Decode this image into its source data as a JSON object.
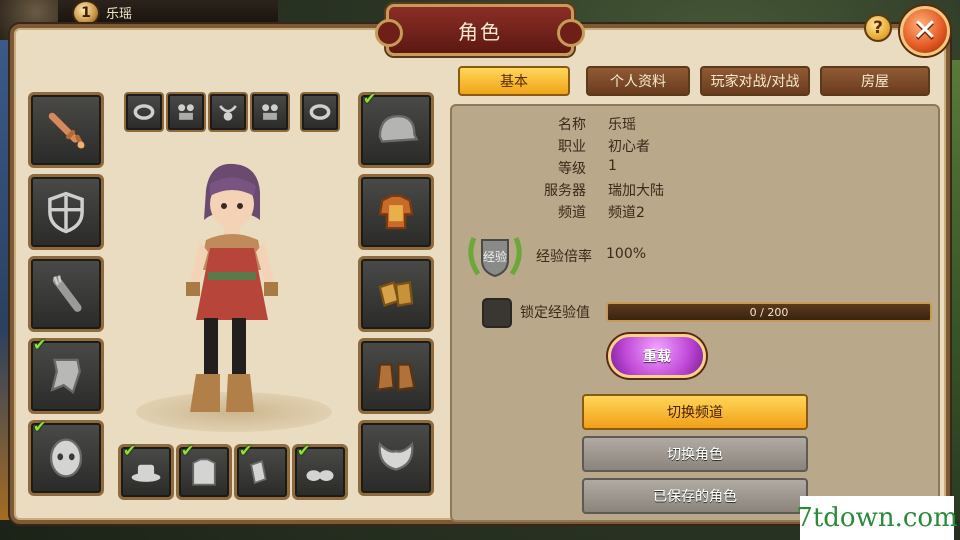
{
  "player": {
    "level": "1",
    "name": "乐瑶"
  },
  "window": {
    "title": "角色",
    "help_label": "?",
    "close_label": "✕"
  },
  "equipment": {
    "left_slots": [
      {
        "icon": "sword-icon",
        "equipped": false
      },
      {
        "icon": "shield-icon",
        "equipped": false
      },
      {
        "icon": "quiver-icon",
        "equipped": false
      },
      {
        "icon": "cape-icon",
        "equipped": true
      },
      {
        "icon": "mask-icon",
        "equipped": true
      }
    ],
    "top_slots": [
      {
        "icon": "ring-icon"
      },
      {
        "icon": "earring-icon"
      },
      {
        "icon": "pendant-icon"
      },
      {
        "icon": "earring-icon"
      },
      {
        "icon": "ring-icon"
      }
    ],
    "right_slots": [
      {
        "icon": "helmet-icon",
        "equipped": true
      },
      {
        "icon": "armor-icon",
        "equipped": false
      },
      {
        "icon": "gloves-icon",
        "equipped": false
      },
      {
        "icon": "boots-icon",
        "equipped": false
      },
      {
        "icon": "wings-icon",
        "equipped": false
      }
    ],
    "bottom_slots": [
      {
        "icon": "hat-icon",
        "equipped": true
      },
      {
        "icon": "shirt-icon",
        "equipped": true
      },
      {
        "icon": "gloves-icon",
        "equipped": true
      },
      {
        "icon": "shoes-icon",
        "equipped": true
      }
    ],
    "check_mark": "✔"
  },
  "tabs": [
    {
      "label": "基本",
      "active": true
    },
    {
      "label": "个人资料",
      "active": false
    },
    {
      "label": "玩家对战/对战",
      "active": false
    },
    {
      "label": "房屋",
      "active": false
    }
  ],
  "info": {
    "rows": [
      {
        "label": "名称",
        "value": "乐瑶"
      },
      {
        "label": "职业",
        "value": "初心者"
      },
      {
        "label": "等级",
        "value": "1"
      },
      {
        "label": "服务器",
        "value": "瑞加大陆"
      },
      {
        "label": "频道",
        "value": "频道2"
      }
    ],
    "exp_badge": "经验",
    "exp_rate_label": "经验倍率",
    "exp_rate_value": "100%",
    "lock_exp_label": "锁定经验值",
    "exp_progress_text": "0 / 200",
    "exp_progress_fraction": 0
  },
  "buttons": {
    "reload": "重载",
    "switch_channel": "切换频道",
    "switch_character": "切换角色",
    "saved_characters": "已保存的角色"
  },
  "watermark": "7tdown.com"
}
